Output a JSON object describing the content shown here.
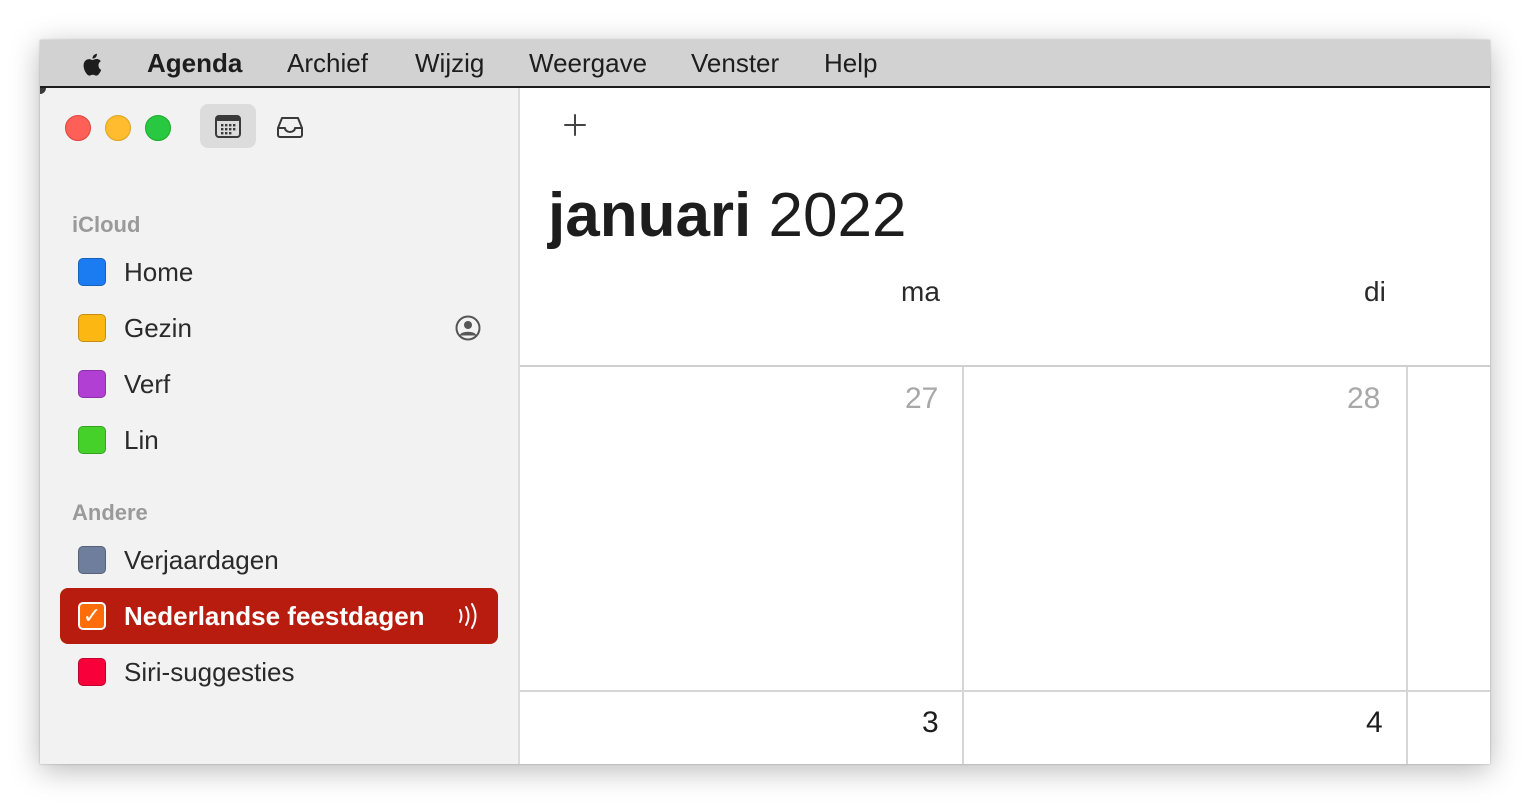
{
  "menubar": {
    "app_name": "Agenda",
    "items": [
      "Archief",
      "Wijzig",
      "Weergave",
      "Venster",
      "Help"
    ]
  },
  "sidebar": {
    "sections": [
      {
        "label": "iCloud",
        "calendars": [
          {
            "name": "Home",
            "color": "#1b7cf2"
          },
          {
            "name": "Gezin",
            "color": "#fdb713",
            "shared": true
          },
          {
            "name": "Verf",
            "color": "#b13fd4"
          },
          {
            "name": "Lin",
            "color": "#46d02a"
          }
        ]
      },
      {
        "label": "Andere",
        "calendars": [
          {
            "name": "Verjaardagen",
            "color": "#6e7e9c"
          },
          {
            "name": "Nederlandse feestdagen",
            "color": "#ff6d0b",
            "selected": true,
            "checked": true,
            "subscribed": true
          },
          {
            "name": "Siri-suggesties",
            "color": "#f8003a"
          }
        ]
      }
    ]
  },
  "main": {
    "add_button": "+",
    "month": "januari",
    "year": "2022",
    "weekdays": [
      "ma",
      "di"
    ],
    "weeks": [
      [
        "27",
        "28"
      ],
      [
        "3",
        "4"
      ]
    ]
  },
  "colors": {
    "selection": "#b71c0e",
    "menubar": "#d2d2d2",
    "sidebar": "#f2f2f2"
  },
  "icons": {
    "apple": "apple-icon",
    "calendar_view": "calendar-icon",
    "inbox": "inbox-icon",
    "shared": "person-circle-icon",
    "subscribed": "broadcast-icon",
    "add": "plus-icon"
  }
}
